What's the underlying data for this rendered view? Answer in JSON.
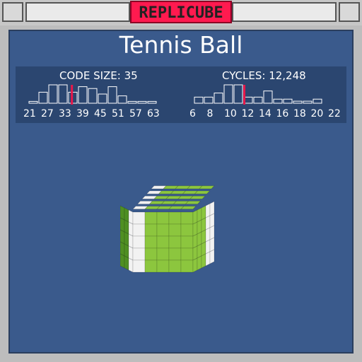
{
  "app": {
    "title": "REPLICUBE"
  },
  "puzzle": {
    "name": "Tennis Ball"
  },
  "stats": {
    "code_size": {
      "label": "CODE SIZE: 35",
      "ticks": [
        "21",
        "27",
        "33",
        "39",
        "45",
        "51",
        "57",
        "63"
      ],
      "marker_value": 35,
      "range": [
        21,
        63
      ],
      "bins": [
        1,
        6,
        10,
        10,
        6,
        9,
        8,
        5,
        9,
        4,
        1,
        1,
        1
      ]
    },
    "cycles": {
      "label": "CYCLES: 12,248",
      "ticks": [
        "6",
        "8",
        "10",
        "12",
        "14",
        "16",
        "18",
        "20",
        "22"
      ],
      "marker_value": 12.2,
      "range": [
        6,
        22
      ],
      "bins": [
        3,
        3,
        5,
        9,
        9,
        3,
        3,
        6,
        2,
        2,
        1,
        1,
        2
      ]
    }
  },
  "colors": {
    "accent": "#ff1a4f",
    "panel": "#3a5a8c",
    "stats_bg": "#2b4670",
    "marker": "#e8174a",
    "cube_green": "#8cc63e",
    "cube_dark_green": "#4f8f22",
    "cube_white": "#f2f2f2"
  }
}
